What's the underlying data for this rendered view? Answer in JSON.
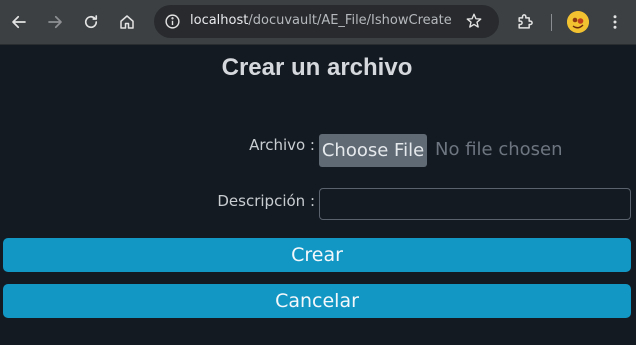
{
  "browser": {
    "url_host": "localhost",
    "url_path": "/docuvault/AE_File/IshowCreate",
    "icons": {
      "back": "arrow-left-icon",
      "forward": "arrow-right-icon",
      "reload": "reload-icon",
      "home": "home-icon",
      "site_info": "info-icon",
      "bookmark": "star-icon",
      "extensions": "puzzle-icon",
      "profile": "avatar",
      "menu": "kebab-menu-icon"
    }
  },
  "page": {
    "title": "Crear un archivo",
    "file_field": {
      "label": "Archivo :",
      "button_label": "Choose File",
      "status": "No file chosen"
    },
    "description_field": {
      "label": "Descripción :",
      "value": "",
      "placeholder": ""
    },
    "buttons": {
      "create": "Crear",
      "cancel": "Cancelar"
    }
  },
  "colors": {
    "page_background": "#141a21",
    "button_primary": "#1297c4",
    "file_button": "#5f6a75"
  }
}
